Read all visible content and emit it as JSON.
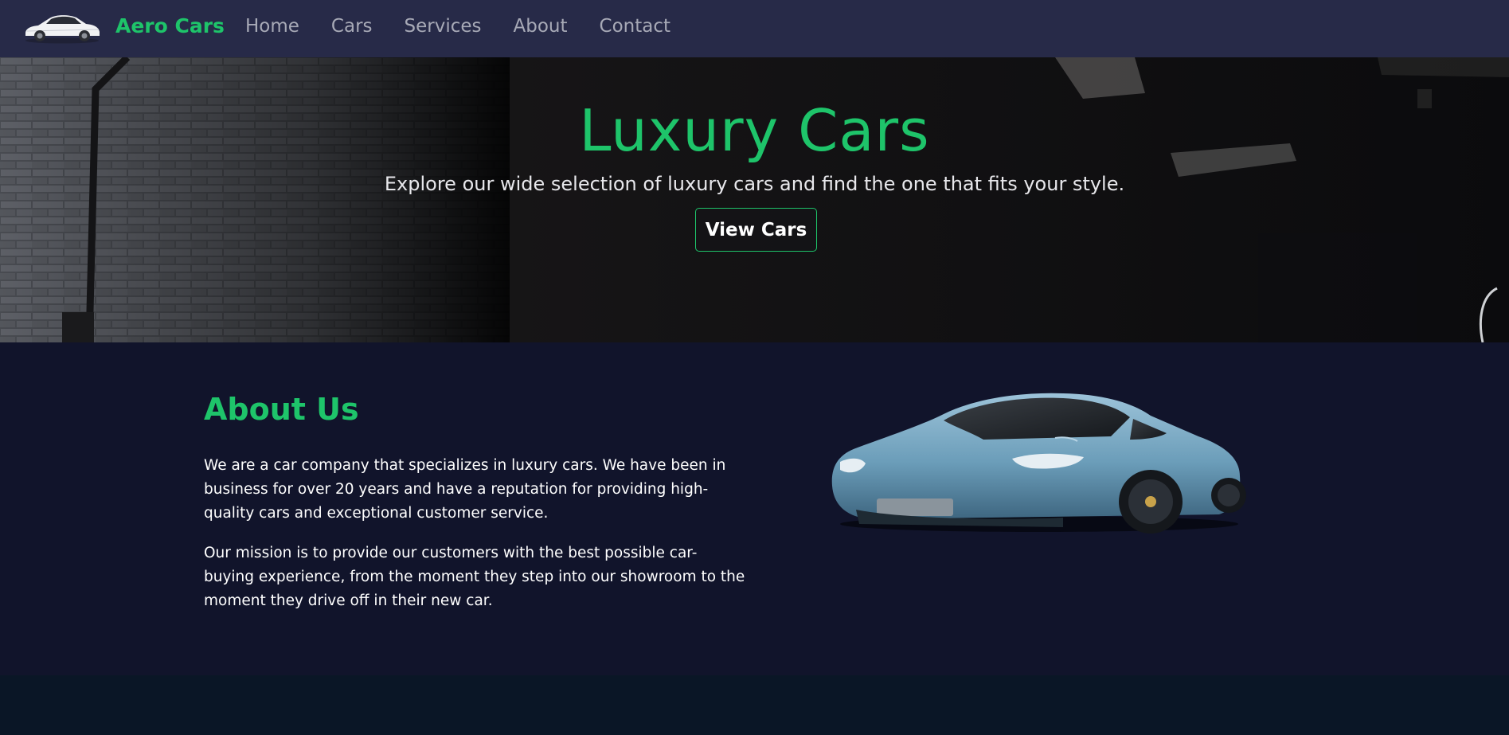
{
  "navbar": {
    "logo_icon": "car-logo-icon",
    "brand": "Aero Cars",
    "links": [
      "Home",
      "Cars",
      "Services",
      "About",
      "Contact"
    ]
  },
  "hero": {
    "title": "Luxury Cars",
    "subtitle": "Explore our wide selection of luxury cars and find the one that fits your style.",
    "button_label": "View Cars"
  },
  "about": {
    "heading": "About Us",
    "paragraphs": [
      "We are a car company that specializes in luxury cars. We have been in business for over 20 years and have a reputation for providing high-quality cars and exceptional customer service.",
      "Our mission is to provide our customers with the best possible car-buying experience, from the moment they step into our showroom to the moment they drive off in their new car."
    ],
    "image_icon": "blue-sports-car-image"
  },
  "colors": {
    "accent": "#1ec46a",
    "navbar_bg": "#272a48",
    "about_bg": "#11142b",
    "bottom_bg": "#0a1626"
  }
}
